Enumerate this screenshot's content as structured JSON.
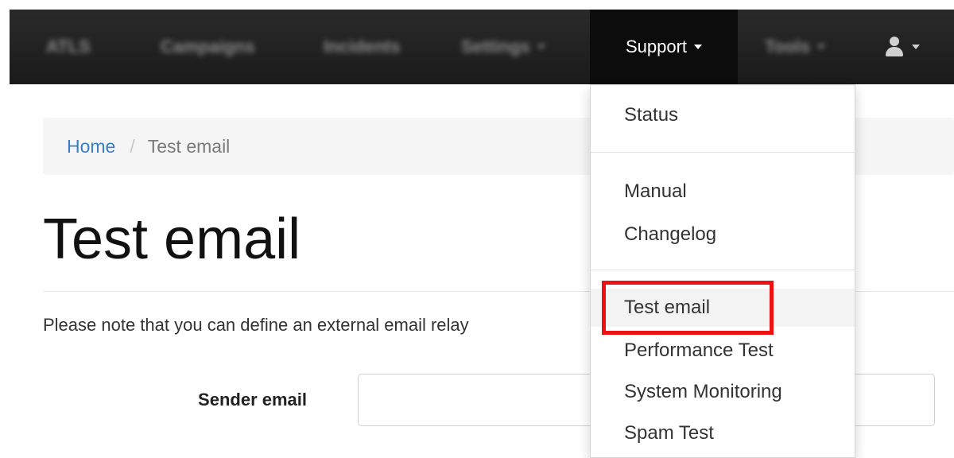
{
  "navbar": {
    "brand": "ATLS",
    "items": [
      {
        "label": "Campaigns"
      },
      {
        "label": "Incidents"
      },
      {
        "label": "Settings"
      },
      {
        "label": "Support"
      },
      {
        "label": "Tools"
      }
    ]
  },
  "breadcrumb": {
    "home": "Home",
    "separator": "/",
    "current": "Test email"
  },
  "page": {
    "title": "Test email",
    "note": "Please note that you can define an external email relay"
  },
  "form": {
    "sender_label": "Sender email",
    "sender_value": ""
  },
  "dropdown": {
    "items": [
      {
        "label": "Status"
      },
      {
        "label": "Manual"
      },
      {
        "label": "Changelog"
      },
      {
        "label": "Test email"
      },
      {
        "label": "Performance Test"
      },
      {
        "label": "System Monitoring"
      },
      {
        "label": "Spam Test"
      }
    ]
  },
  "colors": {
    "highlight_box": "#ee1111",
    "link": "#3a7fc4",
    "navbar": "#1a1a1a"
  }
}
